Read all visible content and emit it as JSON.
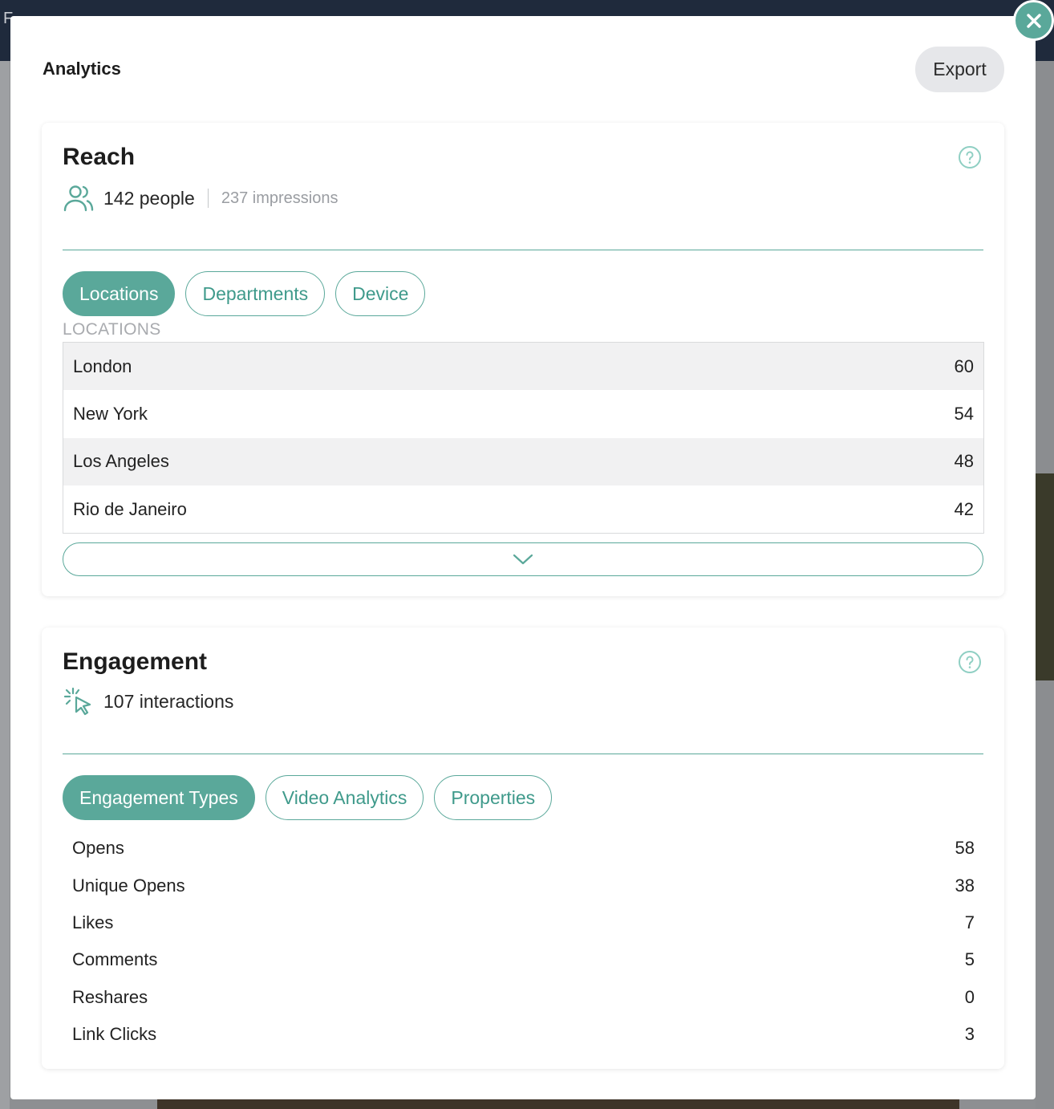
{
  "modal": {
    "title": "Analytics",
    "export_label": "Export"
  },
  "reach": {
    "title": "Reach",
    "people": "142 people",
    "impressions": "237 impressions",
    "tabs": [
      "Locations",
      "Departments",
      "Device"
    ],
    "active_tab": "Locations",
    "section_label": "LOCATIONS",
    "locations": [
      {
        "name": "London",
        "count": "60"
      },
      {
        "name": "New York",
        "count": "54"
      },
      {
        "name": "Los Angeles",
        "count": "48"
      },
      {
        "name": "Rio de Janeiro",
        "count": "42"
      }
    ]
  },
  "engagement": {
    "title": "Engagement",
    "interactions": "107 interactions",
    "tabs": [
      "Engagement Types",
      "Video Analytics",
      "Properties"
    ],
    "active_tab": "Engagement Types",
    "types": [
      {
        "name": "Opens",
        "count": "58"
      },
      {
        "name": "Unique Opens",
        "count": "38"
      },
      {
        "name": "Likes",
        "count": "7"
      },
      {
        "name": "Comments",
        "count": "5"
      },
      {
        "name": "Reshares",
        "count": "0"
      },
      {
        "name": "Link Clicks",
        "count": "3"
      }
    ]
  },
  "icons": {
    "close": "close-icon",
    "help": "question-circle-icon",
    "people": "people-icon",
    "interactions": "cursor-click-icon",
    "expand": "chevron-down-icon"
  },
  "colors": {
    "accent": "#5aa89a",
    "export_bg": "#e6e7ea",
    "row_alt": "#f1f1f2"
  }
}
